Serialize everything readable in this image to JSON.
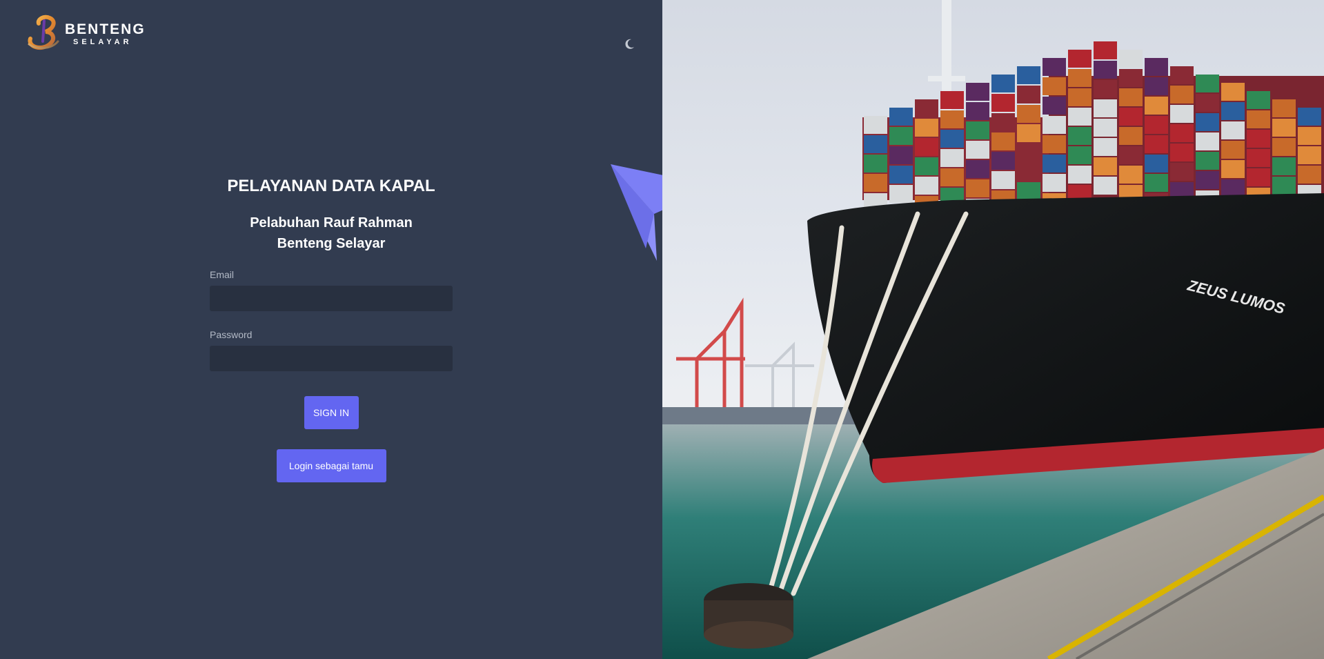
{
  "brand": {
    "name": "BENTENG",
    "sub": "SELAYAR"
  },
  "header": {
    "theme_toggle_icon": "moon-icon"
  },
  "login": {
    "title": "PELAYANAN DATA KAPAL",
    "subtitle_line1": "Pelabuhan Rauf Rahman",
    "subtitle_line2": "Benteng Selayar",
    "email_label": "Email",
    "email_value": "",
    "password_label": "Password",
    "password_value": "",
    "signin_label": "SIGN IN",
    "guest_label": "Login sebagai tamu"
  },
  "photo": {
    "ship_name": "ZEUS LUMOS"
  },
  "colors": {
    "panel_bg": "#323c50",
    "input_bg": "#283040",
    "accent": "#6366f1",
    "label": "#b3bac6"
  }
}
